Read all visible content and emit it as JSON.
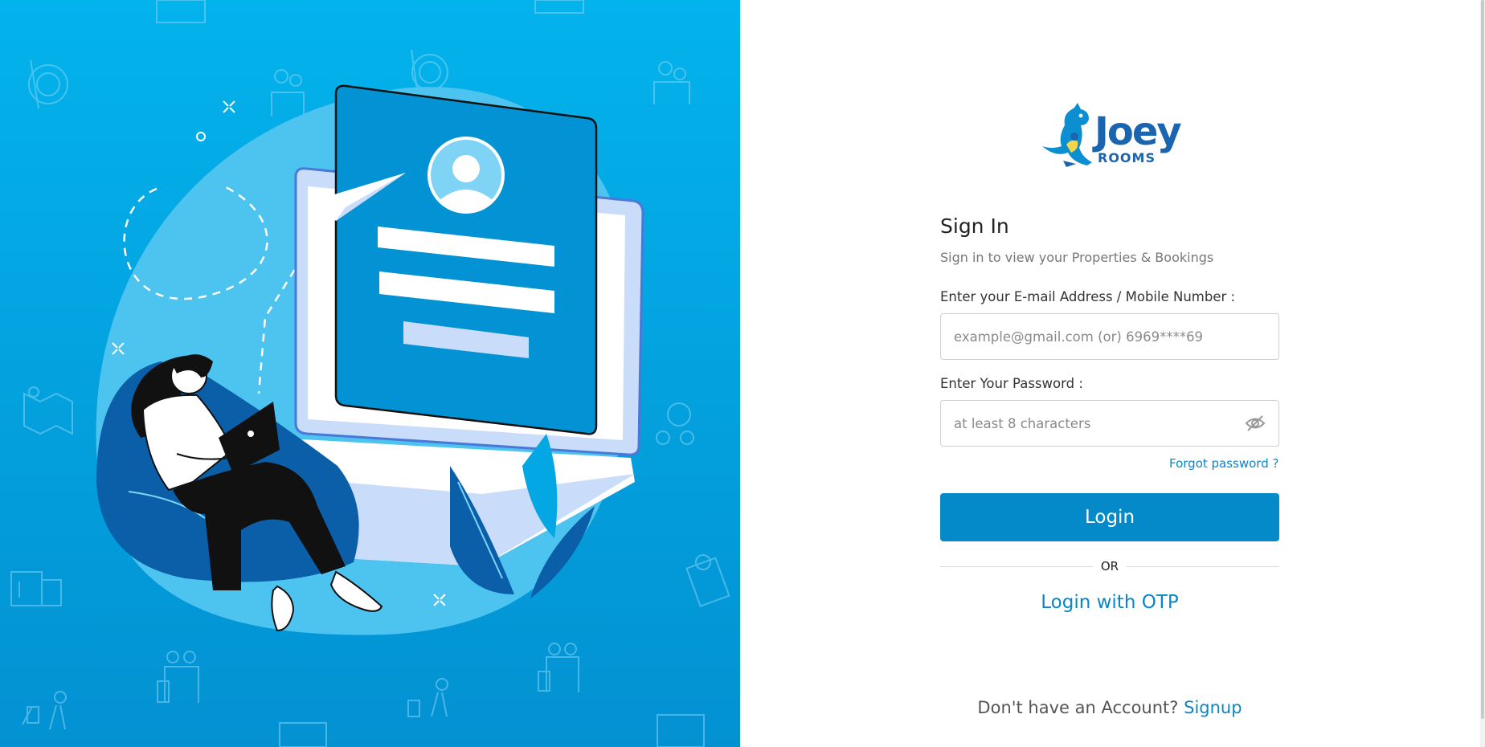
{
  "brand": {
    "logo_alt": "Joey Rooms",
    "name_main": "Joey",
    "name_sub": "ROOMS",
    "color": "#1b65b0"
  },
  "signin": {
    "title": "Sign In",
    "subtitle": "Sign in to view your Properties & Bookings"
  },
  "email_field": {
    "label": "Enter your E-mail Address / Mobile Number :",
    "placeholder": "example@gmail.com (or) 6969****69",
    "value": ""
  },
  "password_field": {
    "label": "Enter Your Password :",
    "placeholder": "at least 8 characters",
    "value": "",
    "toggle_icon": "eye-off-icon"
  },
  "forgot_password": "Forgot password ?",
  "login_button": "Login",
  "divider_text": "OR",
  "otp_link": "Login with OTP",
  "signup": {
    "prompt": "Don't have an Account?",
    "link": "Signup"
  },
  "colors": {
    "accent": "#0489c9",
    "link": "#0a86c8",
    "panel_top": "#03b3ec",
    "panel_bottom": "#0391d2"
  }
}
